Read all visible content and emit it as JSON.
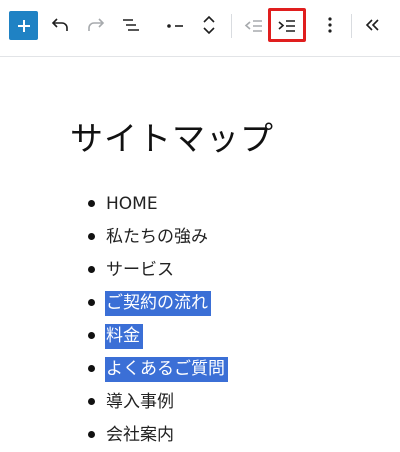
{
  "toolbar": {
    "items": [
      {
        "name": "add-block-button",
        "icon": "plus-icon"
      },
      {
        "name": "undo-button",
        "icon": "undo-icon"
      },
      {
        "name": "redo-button",
        "icon": "redo-icon"
      },
      {
        "name": "document-overview-button",
        "icon": "list-view-icon"
      },
      {
        "name": "block-type-button",
        "icon": "bulleted-list-icon"
      },
      {
        "name": "move-up-down-button",
        "icon": "chevron-up-down-icon"
      },
      {
        "name": "outdent-button",
        "icon": "outdent-icon"
      },
      {
        "name": "indent-button",
        "icon": "indent-icon",
        "highlighted": true
      },
      {
        "name": "more-options-button",
        "icon": "vertical-ellipsis-icon"
      },
      {
        "name": "collapse-button",
        "icon": "double-chevron-left-icon"
      }
    ],
    "accent": "#1f82c4",
    "highlight_color": "#e01e1e"
  },
  "page": {
    "title": "サイトマップ",
    "list": [
      {
        "label": "HOME",
        "selected": false
      },
      {
        "label": "私たちの強み",
        "selected": false
      },
      {
        "label": "サービス",
        "selected": false
      },
      {
        "label": "ご契約の流れ",
        "selected": true
      },
      {
        "label": "料金",
        "selected": true
      },
      {
        "label": "よくあるご質問",
        "selected": true
      },
      {
        "label": "導入事例",
        "selected": false
      },
      {
        "label": "会社案内",
        "selected": false
      }
    ],
    "selection_color": "#3b6fd6"
  }
}
